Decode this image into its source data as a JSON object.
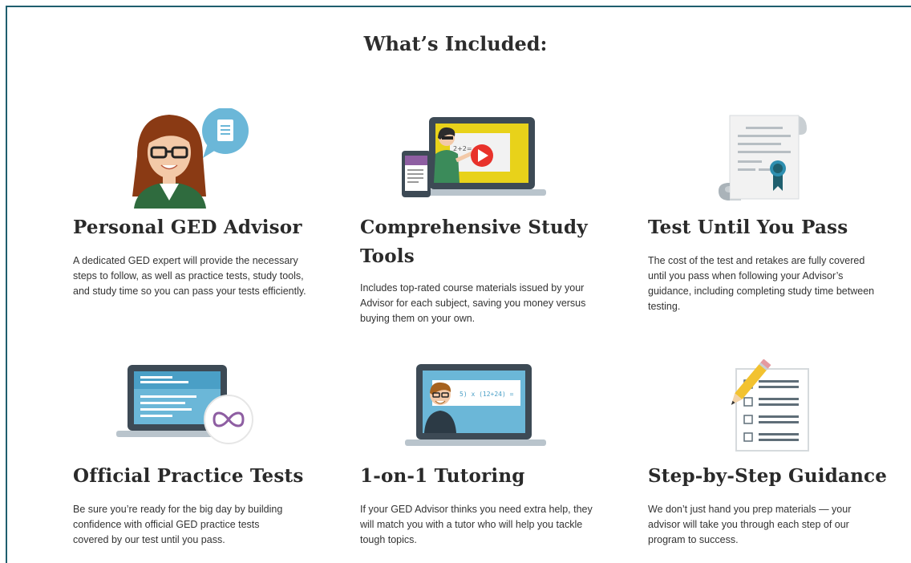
{
  "page": {
    "title": "What’s Included:"
  },
  "features": [
    {
      "title": "Personal GED Advisor",
      "description": "A dedicated GED expert will provide the necessary steps to follow, as well as practice tests, study tools, and study time so you can pass your tests efficiently.",
      "icon": "advisor-illustration"
    },
    {
      "title": "Comprehensive Study Tools",
      "description": "Includes top-rated course materials issued by your Advisor for each subject, saving you money versus buying them on your own.",
      "icon": "study-tools-illustration"
    },
    {
      "title": "Test Until You Pass",
      "description": "The cost of the test and retakes are fully covered until you pass when following your Advisor’s guidance, including completing study time between testing.",
      "icon": "certificate-illustration"
    },
    {
      "title": "Official Practice Tests",
      "description": "Be sure you’re ready for the big day by building confidence with official GED practice tests covered by our test until you pass.",
      "icon": "practice-tests-illustration"
    },
    {
      "title": "1-on-1 Tutoring",
      "description": "If your GED Advisor thinks you need extra help, they will match you with a tutor who will help you tackle tough topics.",
      "icon": "tutoring-illustration",
      "board_text": "5) x (12+24) ="
    },
    {
      "title": "Step-by-Step Guidance",
      "description": "We don’t just hand you prep materials — your advisor will take you through each step of our program to success.",
      "icon": "checklist-illustration"
    }
  ],
  "colors": {
    "teal": "#6bb7d8",
    "dark_teal": "#1f5f6e",
    "yellow": "#e8d21a",
    "red": "#e8322b",
    "green": "#2f6b3e",
    "purple": "#8e5ea2"
  }
}
